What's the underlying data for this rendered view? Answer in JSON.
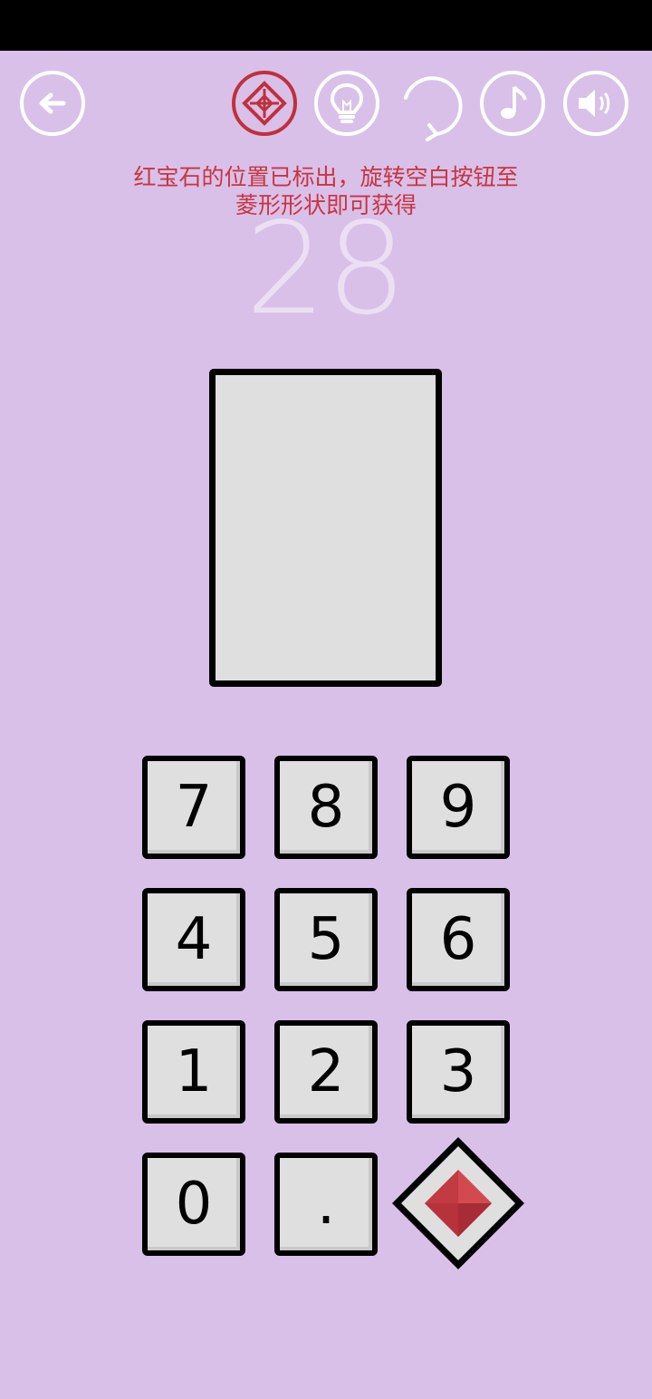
{
  "toolbar": {
    "back_icon": "arrow-left-icon",
    "gem_icon": "diamond-target-icon",
    "hint_icon": "lightbulb-icon",
    "restart_icon": "refresh-icon",
    "music_icon": "music-note-icon",
    "sound_icon": "speaker-icon"
  },
  "hint_lines": [
    "红宝石的位置已标出，旋转空白按钮至",
    "菱形形状即可获得"
  ],
  "level_number": "28",
  "keypad": {
    "rows": [
      [
        "7",
        "8",
        "9"
      ],
      [
        "4",
        "5",
        "6"
      ],
      [
        "1",
        "2",
        "3"
      ],
      [
        "0",
        "."
      ]
    ],
    "special_key_icon": "red-gem-icon"
  },
  "colors": {
    "background": "#d9c0e9",
    "accent_red": "#c0303c",
    "key_face": "#dfdfdf",
    "level_text": "#ecdff4"
  }
}
